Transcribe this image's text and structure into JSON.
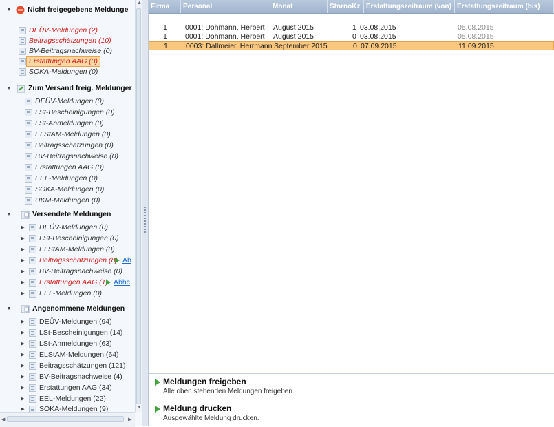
{
  "tree": {
    "groups": [
      {
        "label": "Nicht freigegebene Meldunge",
        "items": [
          {
            "label": "DEÜV-Meldungen (2)",
            "style": "red"
          },
          {
            "label": "Beitragsschätzungen (10)",
            "style": "red"
          },
          {
            "label": "BV-Beitragsnachweise (0)",
            "style": "normal"
          },
          {
            "label": "Erstattungen AAG (3)",
            "style": "red",
            "selected": true
          },
          {
            "label": "SOKA-Meldungen (0)",
            "style": "normal"
          }
        ]
      },
      {
        "label": "Zum Versand freig. Meldunger",
        "items": [
          {
            "label": "DEÜV-Meldungen (0)",
            "style": "normal"
          },
          {
            "label": "LSt-Bescheinigungen (0)",
            "style": "normal"
          },
          {
            "label": "LSt-Anmeldungen (0)",
            "style": "normal"
          },
          {
            "label": "ELStAM-Meldungen (0)",
            "style": "normal"
          },
          {
            "label": "Beitragsschätzungen (0)",
            "style": "normal"
          },
          {
            "label": "BV-Beitragsnachweise (0)",
            "style": "normal"
          },
          {
            "label": "Erstattungen AAG (0)",
            "style": "normal"
          },
          {
            "label": "EEL-Meldungen (0)",
            "style": "normal"
          },
          {
            "label": "SOKA-Meldungen (0)",
            "style": "normal"
          },
          {
            "label": "UKM-Meldungen (0)",
            "style": "normal"
          }
        ]
      },
      {
        "label": "Versendete Meldungen",
        "items": [
          {
            "label": "DEÜV-Meldungen (0)",
            "style": "normal"
          },
          {
            "label": "LSt-Bescheinigungen (0)",
            "style": "normal"
          },
          {
            "label": "ELStAM-Meldungen (0)",
            "style": "normal"
          },
          {
            "label": "Beitragsschätzungen (8)",
            "style": "red",
            "link": "Ab"
          },
          {
            "label": "BV-Beitragsnachweise (0)",
            "style": "normal"
          },
          {
            "label": "Erstattungen AAG (1)",
            "style": "red",
            "link": "Abhc"
          },
          {
            "label": "EEL-Meldungen (0)",
            "style": "normal"
          }
        ]
      },
      {
        "label": "Angenommene Meldungen",
        "items": [
          {
            "label": "DEÜV-Meldungen (94)",
            "style": "plain"
          },
          {
            "label": "LSt-Bescheinigungen (14)",
            "style": "plain"
          },
          {
            "label": "LSt-Anmeldungen (63)",
            "style": "plain"
          },
          {
            "label": "ELStAM-Meldungen (64)",
            "style": "plain"
          },
          {
            "label": "Beitragsschätzungen (121)",
            "style": "plain"
          },
          {
            "label": "BV-Beitragsnachweise (4)",
            "style": "plain"
          },
          {
            "label": "Erstattungen AAG (34)",
            "style": "plain"
          },
          {
            "label": "EEL-Meldungen (22)",
            "style": "plain"
          },
          {
            "label": "SOKA-Meldungen (9)",
            "style": "plain"
          }
        ]
      }
    ]
  },
  "grid": {
    "columns": [
      "Firma",
      "Personal",
      "Monat",
      "StornoKz",
      "Erstattungszeitraum (von)",
      "Erstattungszeitraum (bis)"
    ],
    "rows": [
      {
        "firma": "1",
        "personal": "0001: Dohmann, Herbert",
        "monat": "August 2015",
        "storno": "1",
        "von": "03.08.2015",
        "bis": "05.08.2015",
        "selected": false
      },
      {
        "firma": "1",
        "personal": "0001: Dohmann, Herbert",
        "monat": "August 2015",
        "storno": "0",
        "von": "03.08.2015",
        "bis": "05.08.2015",
        "selected": false
      },
      {
        "firma": "1",
        "personal": "0003: Dallmeier, Herrmann",
        "monat": "September 2015",
        "storno": "0",
        "von": "07.09.2015",
        "bis": "11.09.2015",
        "selected": true
      }
    ]
  },
  "actions": [
    {
      "title": "Meldungen freigeben",
      "desc": "Alle oben stehenden Meldungen freigeben."
    },
    {
      "title": "Meldung drucken",
      "desc": "Ausgewählte Meldung drucken."
    }
  ],
  "colors": {
    "accent": "#3ea33a",
    "selection": "#f9c77e",
    "error": "#d0201e",
    "header": "#a9bcd3"
  }
}
